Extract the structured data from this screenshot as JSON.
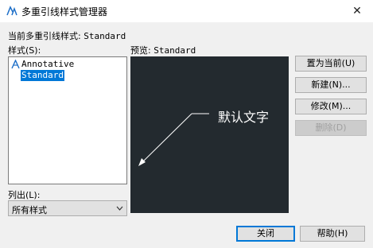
{
  "window": {
    "title": "多重引线样式管理器",
    "close_label": "✕"
  },
  "current_style": {
    "label": "当前多重引线样式:",
    "value": "Standard"
  },
  "styles": {
    "label": "样式(S):",
    "items": [
      {
        "label": "Annotative",
        "icon": "annotative-icon",
        "selected": false
      },
      {
        "label": "Standard",
        "selected": true
      }
    ]
  },
  "preview": {
    "label": "预览:",
    "name": "Standard",
    "sample_text": "默认文字"
  },
  "buttons": {
    "set_current": "置为当前(U)",
    "new": "新建(N)...",
    "modify": "修改(M)...",
    "delete": "删除(D)",
    "close": "关闭",
    "help": "帮助(H)"
  },
  "list_filter": {
    "label": "列出(L):",
    "value": "所有样式"
  },
  "colors": {
    "preview_bg": "#232a2f",
    "selection": "#0078d7"
  }
}
